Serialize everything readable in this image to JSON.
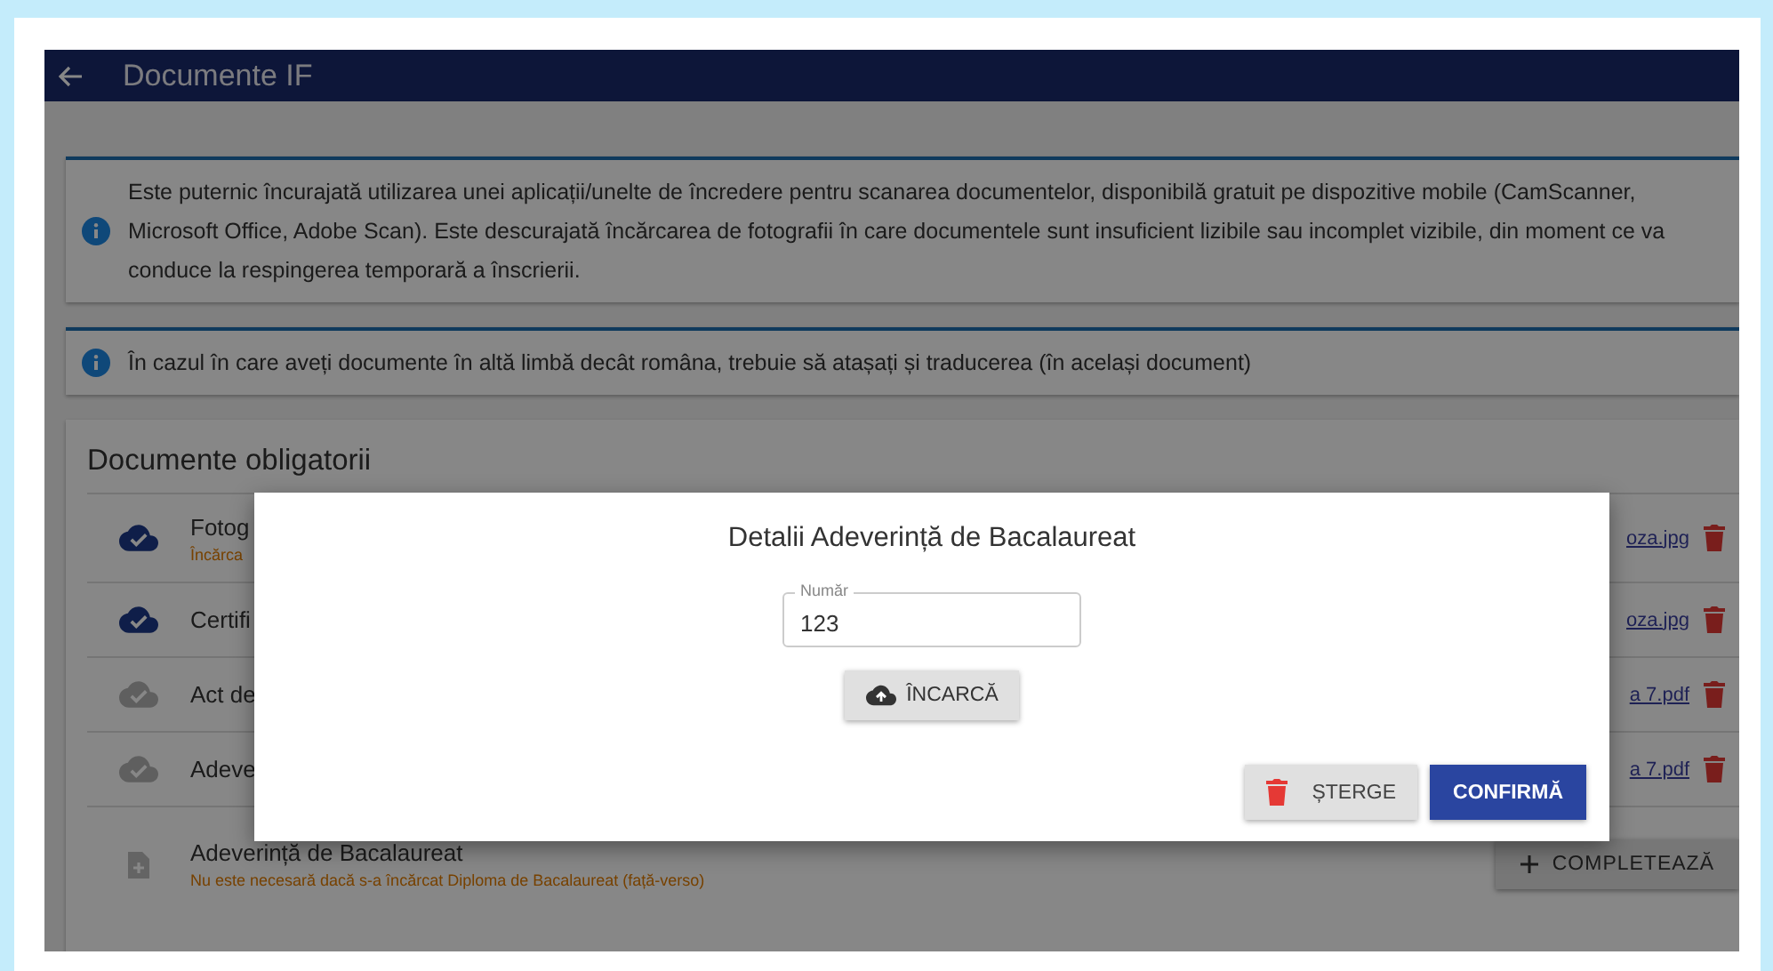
{
  "header": {
    "title": "Documente IF"
  },
  "notices": [
    {
      "text": "Este puternic încurajată utilizarea unei aplicații/unelte de încredere pentru scanarea documentelor, disponibilă gratuit pe dispozitive mobile (CamScanner, Microsoft Office, Adobe Scan). Este descurajată încărcarea de fotografii în care documentele sunt insuficient lizibile sau incomplet vizibile, din moment ce va conduce la respingerea temporară a înscrierii."
    },
    {
      "text": "În cazul în care aveți documente în altă limbă decât româna, trebuie să atașați și traducerea (în același document)"
    }
  ],
  "required_documents": {
    "title": "Documente obligatorii",
    "items": [
      {
        "kind": "file",
        "name": "Fotog",
        "note": "Încărca",
        "uploaded": true,
        "file": "oza.jpg"
      },
      {
        "kind": "file",
        "name": "Certifi",
        "uploaded": true,
        "file": "oza.jpg"
      },
      {
        "kind": "file",
        "name": "Act de",
        "uploaded": false,
        "file": "a 7.pdf"
      },
      {
        "kind": "file",
        "name": "Adeve",
        "uploaded": false,
        "file": "a 7.pdf"
      },
      {
        "kind": "missing",
        "name": "Adeverință de Bacalaureat",
        "note": "Nu este necesară dacă s-a încărcat Diploma de Bacalaureat (față-verso)",
        "action": "COMPLETEAZĂ"
      }
    ]
  },
  "dialog": {
    "title": "Detalii Adeverință de Bacalaureat",
    "field": {
      "label": "Număr",
      "value": "123"
    },
    "upload_button": "ÎNCARCĂ",
    "delete_button": "ȘTERGE",
    "confirm_button": "CONFIRMĂ"
  }
}
